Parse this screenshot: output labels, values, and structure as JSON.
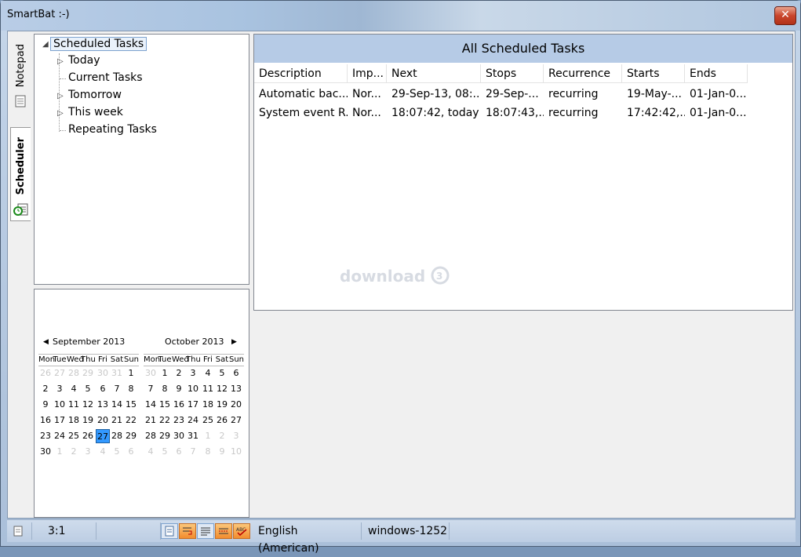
{
  "window": {
    "title": "SmartBat :-)",
    "close_label": "✕"
  },
  "side_tabs": [
    {
      "label": "Notepad",
      "icon": "notepad-icon"
    },
    {
      "label": "Scheduler",
      "icon": "scheduler-icon"
    }
  ],
  "tree": {
    "root": "Scheduled Tasks",
    "items": [
      "Today",
      "Current Tasks",
      "Tomorrow",
      "This week",
      "Repeating Tasks"
    ]
  },
  "calendar": {
    "months": [
      {
        "title": "September 2013",
        "days": [
          "26",
          "27",
          "28",
          "29",
          "30",
          "31",
          "1",
          "2",
          "3",
          "4",
          "5",
          "6",
          "7",
          "8",
          "9",
          "10",
          "11",
          "12",
          "13",
          "14",
          "15",
          "16",
          "17",
          "18",
          "19",
          "20",
          "21",
          "22",
          "23",
          "24",
          "25",
          "26",
          "27",
          "28",
          "29",
          "30",
          "1",
          "2",
          "3",
          "4",
          "5",
          "6"
        ]
      },
      {
        "title": "October 2013",
        "days": [
          "30",
          "1",
          "2",
          "3",
          "4",
          "5",
          "6",
          "7",
          "8",
          "9",
          "10",
          "11",
          "12",
          "13",
          "14",
          "15",
          "16",
          "17",
          "18",
          "19",
          "20",
          "21",
          "22",
          "23",
          "24",
          "25",
          "26",
          "27",
          "28",
          "29",
          "30",
          "31",
          "1",
          "2",
          "3",
          "4",
          "5",
          "6",
          "7",
          "8",
          "9",
          "10"
        ]
      }
    ],
    "weekdays": [
      "Mon",
      "Tue",
      "Wed",
      "Thu",
      "Fri",
      "Sat",
      "Sun"
    ],
    "selected": "27"
  },
  "table": {
    "title": "All Scheduled Tasks",
    "columns": [
      "Description",
      "Imp...",
      "Next",
      "Stops",
      "Recurrence",
      "Starts",
      "Ends"
    ],
    "rows": [
      [
        "Automatic bac...",
        "Nor...",
        "29-Sep-13, 08:...",
        "29-Sep-...",
        "recurring",
        "19-May-...",
        "01-Jan-0..."
      ],
      [
        "System event R...",
        "Nor...",
        "18:07:42, today",
        "18:07:43,...",
        "recurring",
        "17:42:42,...",
        "01-Jan-0..."
      ]
    ]
  },
  "watermark": "download",
  "statusbar": {
    "position": "3:1",
    "language": "English (American)",
    "encoding": "windows-1252"
  }
}
